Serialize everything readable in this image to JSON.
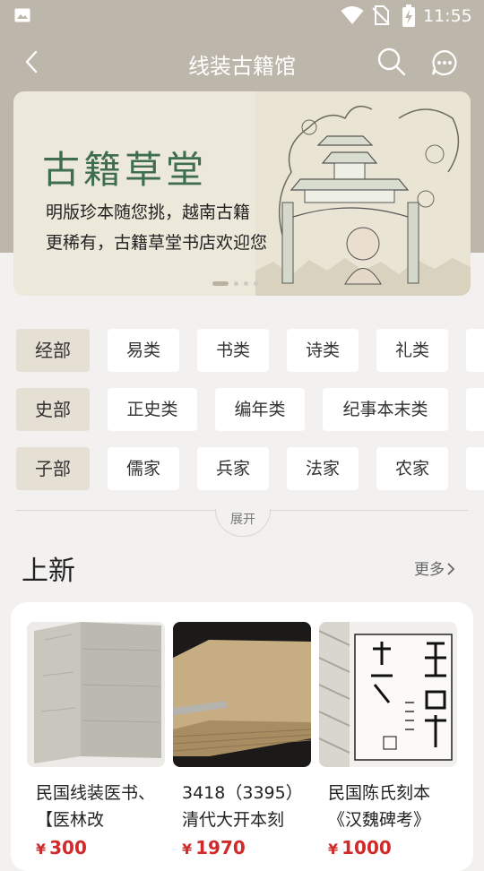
{
  "status_bar": {
    "time": "11:55"
  },
  "header": {
    "title": "线装古籍馆"
  },
  "banner": {
    "heading": "古籍草堂",
    "line1": "明版珍本随您挑，越南古籍",
    "line2": "更稀有，古籍草堂书店欢迎您",
    "slide_count": 5,
    "active_slide": 1
  },
  "categories": [
    {
      "label": "经部",
      "items": [
        "易类",
        "书类",
        "诗类",
        "礼类"
      ]
    },
    {
      "label": "史部",
      "items": [
        "正史类",
        "编年类",
        "纪事本末类"
      ]
    },
    {
      "label": "子部",
      "items": [
        "儒家",
        "兵家",
        "法家",
        "农家"
      ]
    }
  ],
  "expand_label": "展开",
  "new_section": {
    "title": "上新",
    "more_label": "更多"
  },
  "products": [
    {
      "name": "民国线装医书、【医林改",
      "currency": "¥",
      "price": "300"
    },
    {
      "name": "3418（3395）清代大开本刻",
      "currency": "¥",
      "price": "1970"
    },
    {
      "name": "民国陈氏刻本《汉魏碑考》",
      "currency": "¥",
      "price": "1000"
    }
  ],
  "colors": {
    "price_red": "#d02a2a",
    "banner_green": "#3e6e4f",
    "top_bg": "#bdb6aa"
  }
}
